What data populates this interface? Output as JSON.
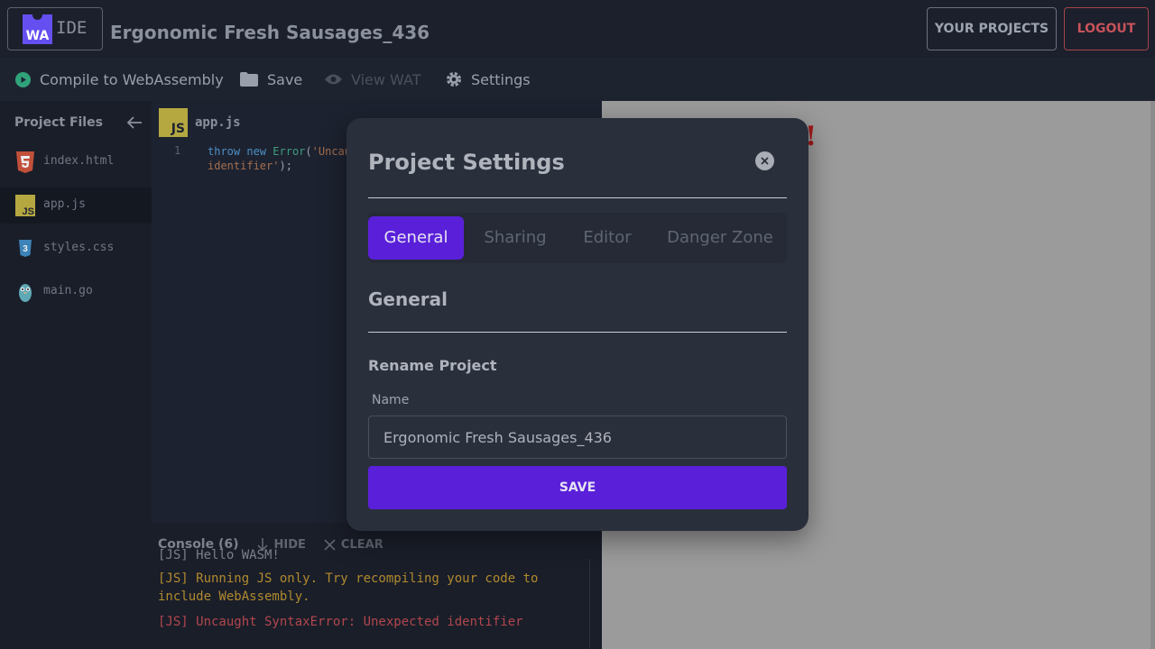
{
  "header": {
    "logo_wa": "WA",
    "logo_ide": "IDE",
    "project_title": "Ergonomic Fresh Sausages_436",
    "your_projects": "YOUR PROJECTS",
    "logout": "LOGOUT"
  },
  "toolbar": {
    "compile": "Compile to WebAssembly",
    "save": "Save",
    "view_wat": "View WAT",
    "settings": "Settings"
  },
  "sidebar": {
    "title": "Project Files",
    "files": [
      {
        "name": "index.html",
        "icon": "html5-icon"
      },
      {
        "name": "app.js",
        "icon": "js-icon"
      },
      {
        "name": "styles.css",
        "icon": "css3-icon"
      },
      {
        "name": "main.go",
        "icon": "gopher-icon"
      }
    ]
  },
  "editor": {
    "tab_name": "app.js",
    "tab_badge": "JS",
    "line_number": "1",
    "code_kw1": "throw",
    "code_kw2": "new",
    "code_fn": "Error",
    "code_str1": "'Uncau",
    "code_str2": "identifier'",
    "code_end": ");"
  },
  "console": {
    "title": "Console (6)",
    "hide": "HIDE",
    "clear": "CLEAR",
    "logs": [
      {
        "text": "[JS] Hello WASM!",
        "color": "#7a7f89"
      },
      {
        "text": "[JS] Running JS only. Try recompiling your code to\ninclude WebAssembly.",
        "color": "#b08a2e"
      },
      {
        "text": "[JS] Uncaught SyntaxError: Unexpected identifier",
        "color": "#b2464d"
      }
    ]
  },
  "preview": {
    "bang": "!"
  },
  "modal": {
    "title": "Project Settings",
    "tabs": [
      "General",
      "Sharing",
      "Editor",
      "Danger Zone"
    ],
    "active_tab": "General",
    "section_title": "General",
    "subsection_title": "Rename Project",
    "name_label": "Name",
    "name_value": "Ergonomic Fresh Sausages_436",
    "save_label": "SAVE"
  },
  "colors": {
    "accent": "#5a20d9",
    "logout": "#c7525a",
    "wasm_logo": "#654ff0"
  }
}
